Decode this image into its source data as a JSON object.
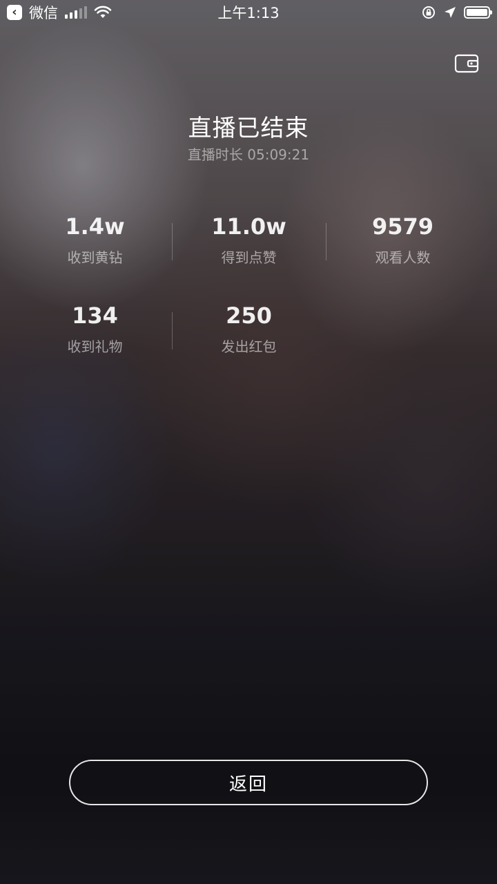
{
  "status_bar": {
    "back_app": "微信",
    "time": "上午1:13",
    "icons": [
      "signal-icon",
      "wifi-icon",
      "orientation-lock-icon",
      "location-icon",
      "battery-icon"
    ]
  },
  "header": {
    "wallet_icon": "wallet-icon"
  },
  "summary": {
    "title": "直播已结束",
    "duration_label": "直播时长",
    "duration_value": "05:09:21"
  },
  "stats": [
    {
      "value": "1.4w",
      "label": "收到黄钻"
    },
    {
      "value": "11.0w",
      "label": "得到点赞"
    },
    {
      "value": "9579",
      "label": "观看人数"
    },
    {
      "value": "134",
      "label": "收到礼物"
    },
    {
      "value": "250",
      "label": "发出红包"
    }
  ],
  "actions": {
    "return_label": "返回"
  }
}
